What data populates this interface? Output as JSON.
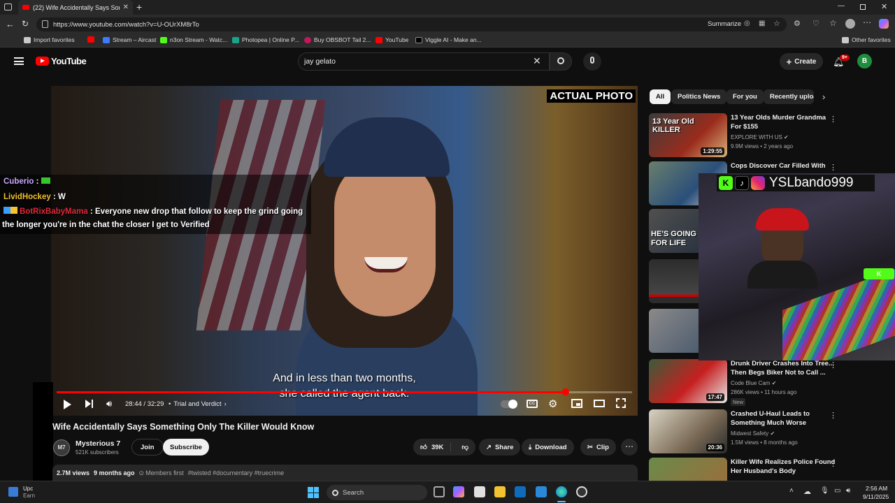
{
  "browser": {
    "tab_title": "(22) Wife Accidentally Says Some",
    "url": "https://www.youtube.com/watch?v=U-OUrXM8rTo",
    "summarize_label": "Summarize",
    "bookmarks": [
      "Import favorites",
      "Stream – Aircast",
      "n3on Stream - Watc...",
      "Photopea | Online P...",
      "Buy OBSBOT Tail 2...",
      "YouTube",
      "Viggle AI - Make an..."
    ],
    "other_favorites": "Other favorites"
  },
  "youtube": {
    "logo": "YouTube",
    "search_value": "jay gelato",
    "create_label": "Create",
    "notif_badge": "9+",
    "avatar_letter": "B"
  },
  "video": {
    "overlay_label": "ACTUAL PHOTO",
    "subtitle_line1": "And in less than two months,",
    "subtitle_line2": "she called the agent back.",
    "time": "28:44 / 32:29",
    "chapter": "Trial and Verdict",
    "progress_fraction": 0.885,
    "chat": [
      {
        "user": "Cuberio",
        "color": "#c9a7ff",
        "text": ""
      },
      {
        "user": "LividHockey",
        "color": "#f3c02a",
        "text": "W"
      },
      {
        "user": "BotRixBabyMama",
        "color": "#e0283a",
        "text": "Everyone new drop that follow to keep the grind going"
      },
      {
        "user": "",
        "color": "#fff",
        "text": "the longer you're in the chat the closer I get to Verified"
      }
    ],
    "stream_handle": "YSLbando999"
  },
  "info": {
    "title": "Wife Accidentally Says Something Only The Killer Would Know",
    "channel": "Mysterious 7",
    "subscribers": "521K subscribers",
    "join": "Join",
    "subscribe": "Subscribe",
    "likes": "39K",
    "share": "Share",
    "download": "Download",
    "clip": "Clip",
    "views": "2.7M views",
    "age": "9 months ago",
    "members": "Members first",
    "tags": "#twisted #documentary #truecrime"
  },
  "chips": [
    "All",
    "Politics News",
    "For you",
    "Recently uploa"
  ],
  "recommended": [
    {
      "title": "13 Year Olds Murder Grandma For $155",
      "channel": "EXPLORE WITH US",
      "meta": "9.9M views • 2 years ago",
      "duration": "1:29:55",
      "thumb_text": "13 Year Old KILLER",
      "badge": ""
    },
    {
      "title": "Cops Discover Car Filled With",
      "channel": "",
      "meta": "",
      "duration": "",
      "thumb_text": "",
      "badge": ""
    },
    {
      "title": "",
      "channel": "",
      "meta": "",
      "duration": "",
      "thumb_text": "HE'S GOING FOR LIFE",
      "badge": ""
    },
    {
      "title": "",
      "channel": "",
      "meta": "",
      "duration": "",
      "thumb_text": "",
      "badge": ""
    },
    {
      "title": "",
      "channel": "",
      "meta": "",
      "duration": "",
      "thumb_text": "",
      "badge": ""
    },
    {
      "title": "Drunk Driver Crashes Into Tree... Then Begs Biker Not to Call ...",
      "channel": "Code Blue Cam",
      "meta": "286K views • 11 hours ago",
      "duration": "17:47",
      "thumb_text": "",
      "badge": "New"
    },
    {
      "title": "Crashed U-Haul Leads to Something Much Worse",
      "channel": "Midwest Safety",
      "meta": "1.5M views • 8 months ago",
      "duration": "20:36",
      "thumb_text": "",
      "badge": ""
    },
    {
      "title": "Killer Wife Realizes Police Found Her Husband's Body",
      "channel": "",
      "meta": "",
      "duration": "",
      "thumb_text": "",
      "badge": ""
    }
  ],
  "taskbar": {
    "search_placeholder": "Search",
    "time": "2:56 AM",
    "date": "9/11/2025",
    "weather": "Upc",
    "weather_sub": "Earn"
  },
  "colors": {
    "accent": "#ff0000",
    "progress_played": "#ff0000",
    "chip_active": "#f1f1f1"
  }
}
